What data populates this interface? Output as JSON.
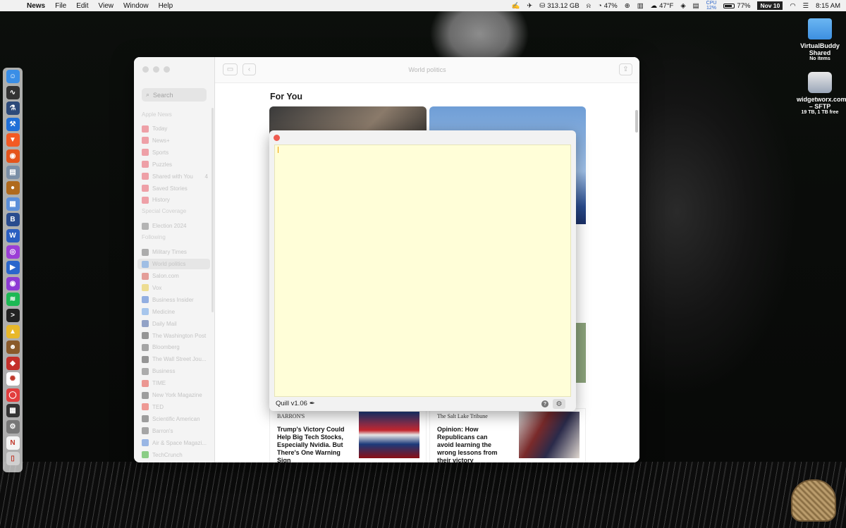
{
  "menubar": {
    "app_name": "News",
    "menus": [
      "File",
      "Edit",
      "View",
      "Window",
      "Help"
    ],
    "disk": "313.12 GB",
    "cpu_percent": "47%",
    "weather": "47°F",
    "cpu_label": "CPU",
    "cpu_usage": "12%",
    "battery": "77%",
    "battery_level": 0.77,
    "date": "Nov 10",
    "time": "8:15 AM"
  },
  "desktop": {
    "items": [
      {
        "label": "VirtualBuddy Shared",
        "sub": "No items"
      },
      {
        "label": "widgetworx.com – SFTP",
        "sub": "19 TB, 1 TB free"
      }
    ]
  },
  "news": {
    "window_title": "World politics",
    "search_placeholder": "Search",
    "sections": {
      "apple_news": "Apple News",
      "special_coverage": "Special Coverage",
      "following": "Following"
    },
    "apple_news_items": [
      {
        "label": "Today",
        "color": "#e6394a"
      },
      {
        "label": "News+",
        "color": "#e6394a"
      },
      {
        "label": "Sports",
        "color": "#e6394a"
      },
      {
        "label": "Puzzles",
        "color": "#e6394a"
      },
      {
        "label": "Shared with You",
        "color": "#e6394a",
        "badge": "4"
      },
      {
        "label": "Saved Stories",
        "color": "#e6394a"
      },
      {
        "label": "History",
        "color": "#e6394a"
      }
    ],
    "special_items": [
      {
        "label": "Election 2024",
        "color": "#666666"
      }
    ],
    "following_items": [
      {
        "label": "Military Times",
        "color": "#555555"
      },
      {
        "label": "World politics",
        "color": "#4a8fe2"
      },
      {
        "label": "Salon.com",
        "color": "#d0362b"
      },
      {
        "label": "Vox",
        "color": "#e4c11b"
      },
      {
        "label": "Business Insider",
        "color": "#1a59c9"
      },
      {
        "label": "Medicine",
        "color": "#4a8fe2"
      },
      {
        "label": "Daily Mail",
        "color": "#1a3d8f"
      },
      {
        "label": "The Washington Post",
        "color": "#222222"
      },
      {
        "label": "Bloomberg",
        "color": "#444444"
      },
      {
        "label": "The Wall Street Jou...",
        "color": "#222222"
      },
      {
        "label": "Business",
        "color": "#555555"
      },
      {
        "label": "TIME",
        "color": "#e1251b"
      },
      {
        "label": "New York Magazine",
        "color": "#333333"
      },
      {
        "label": "TED",
        "color": "#e62b1e"
      },
      {
        "label": "Scientific American",
        "color": "#333333"
      },
      {
        "label": "Barron's",
        "color": "#444444"
      },
      {
        "label": "Air & Space Magazi...",
        "color": "#2a6bd1"
      },
      {
        "label": "TechCrunch",
        "color": "#0a9e01"
      }
    ],
    "main": {
      "heading": "For You",
      "cards": [
        {
          "source": "BARRON'S",
          "headline": "Trump's Victory Could Help Big Tech Stocks, Especially Nvidia. But There's One Warning Sign"
        },
        {
          "source": "The Salt Lake Tribune",
          "headline": "Opinion: How Republicans can avoid learning the wrong lessons from their victory"
        }
      ]
    }
  },
  "quill": {
    "version_label": "Quill v1.06",
    "help_label": "?",
    "editor_bg": "#fffed8"
  },
  "dock_icons": [
    {
      "name": "finder-icon",
      "color": "#3a8ee6",
      "glyph": "☺"
    },
    {
      "name": "activity-monitor-icon",
      "color": "#333333",
      "glyph": "∿"
    },
    {
      "name": "instruments-icon",
      "color": "#2d4a7a",
      "glyph": "⚗"
    },
    {
      "name": "xcode-icon",
      "color": "#1f6fd8",
      "glyph": "⚒"
    },
    {
      "name": "brave-icon",
      "color": "#f25a24",
      "glyph": "▼"
    },
    {
      "name": "firefox-icon",
      "color": "#e5541b",
      "glyph": "◉"
    },
    {
      "name": "preview-icon",
      "color": "#7b8fa6",
      "glyph": "▤"
    },
    {
      "name": "acorn-icon",
      "color": "#b06a1d",
      "glyph": "●"
    },
    {
      "name": "calendar-app-icon",
      "color": "#5b8fd9",
      "glyph": "▦"
    },
    {
      "name": "bbedit-icon",
      "color": "#2a4c8e",
      "glyph": "B"
    },
    {
      "name": "word-icon",
      "color": "#2b5fc1",
      "glyph": "W"
    },
    {
      "name": "nova-icon",
      "color": "#9b3ed6",
      "glyph": "◎"
    },
    {
      "name": "quicktime-icon",
      "color": "#2a66cc",
      "glyph": "▶"
    },
    {
      "name": "podcasts-icon",
      "color": "#8c3ad4",
      "glyph": "◉"
    },
    {
      "name": "spotify-icon",
      "color": "#1db954",
      "glyph": "≋"
    },
    {
      "name": "terminal-icon",
      "color": "#222222",
      "glyph": ">"
    },
    {
      "name": "drive-icon",
      "color": "#e8b82a",
      "glyph": "▲"
    },
    {
      "name": "person-app-icon",
      "color": "#8a5a2b",
      "glyph": "☻"
    },
    {
      "name": "toolbox-icon",
      "color": "#c4302b",
      "glyph": "◆"
    },
    {
      "name": "chatgpt-icon",
      "color": "#ffffff",
      "glyph": "✺"
    },
    {
      "name": "lifesaver-icon",
      "color": "#e23d3d",
      "glyph": "◯"
    },
    {
      "name": "calculator-icon",
      "color": "#333333",
      "glyph": "▦"
    },
    {
      "name": "settings-icon",
      "color": "#777777",
      "glyph": "⚙"
    },
    {
      "name": "news-icon",
      "color": "#f4f4f4",
      "glyph": "N"
    },
    {
      "name": "dock-trash-icon",
      "color": "#d0d0d0",
      "glyph": "▯"
    }
  ]
}
